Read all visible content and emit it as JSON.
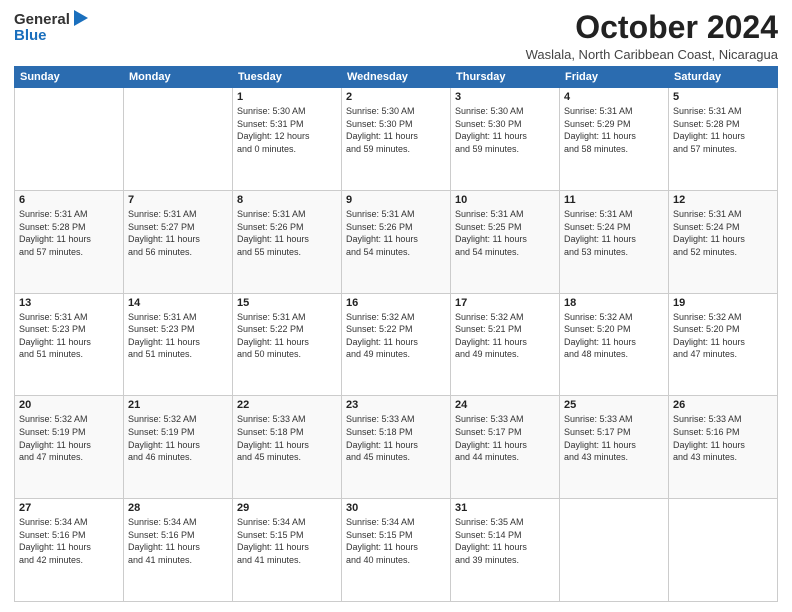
{
  "logo": {
    "general": "General",
    "blue": "Blue"
  },
  "title": {
    "month": "October 2024",
    "location": "Waslala, North Caribbean Coast, Nicaragua"
  },
  "weekdays": [
    "Sunday",
    "Monday",
    "Tuesday",
    "Wednesday",
    "Thursday",
    "Friday",
    "Saturday"
  ],
  "weeks": [
    [
      {
        "day": "",
        "info": ""
      },
      {
        "day": "",
        "info": ""
      },
      {
        "day": "1",
        "info": "Sunrise: 5:30 AM\nSunset: 5:31 PM\nDaylight: 12 hours\nand 0 minutes."
      },
      {
        "day": "2",
        "info": "Sunrise: 5:30 AM\nSunset: 5:30 PM\nDaylight: 11 hours\nand 59 minutes."
      },
      {
        "day": "3",
        "info": "Sunrise: 5:30 AM\nSunset: 5:30 PM\nDaylight: 11 hours\nand 59 minutes."
      },
      {
        "day": "4",
        "info": "Sunrise: 5:31 AM\nSunset: 5:29 PM\nDaylight: 11 hours\nand 58 minutes."
      },
      {
        "day": "5",
        "info": "Sunrise: 5:31 AM\nSunset: 5:28 PM\nDaylight: 11 hours\nand 57 minutes."
      }
    ],
    [
      {
        "day": "6",
        "info": "Sunrise: 5:31 AM\nSunset: 5:28 PM\nDaylight: 11 hours\nand 57 minutes."
      },
      {
        "day": "7",
        "info": "Sunrise: 5:31 AM\nSunset: 5:27 PM\nDaylight: 11 hours\nand 56 minutes."
      },
      {
        "day": "8",
        "info": "Sunrise: 5:31 AM\nSunset: 5:26 PM\nDaylight: 11 hours\nand 55 minutes."
      },
      {
        "day": "9",
        "info": "Sunrise: 5:31 AM\nSunset: 5:26 PM\nDaylight: 11 hours\nand 54 minutes."
      },
      {
        "day": "10",
        "info": "Sunrise: 5:31 AM\nSunset: 5:25 PM\nDaylight: 11 hours\nand 54 minutes."
      },
      {
        "day": "11",
        "info": "Sunrise: 5:31 AM\nSunset: 5:24 PM\nDaylight: 11 hours\nand 53 minutes."
      },
      {
        "day": "12",
        "info": "Sunrise: 5:31 AM\nSunset: 5:24 PM\nDaylight: 11 hours\nand 52 minutes."
      }
    ],
    [
      {
        "day": "13",
        "info": "Sunrise: 5:31 AM\nSunset: 5:23 PM\nDaylight: 11 hours\nand 51 minutes."
      },
      {
        "day": "14",
        "info": "Sunrise: 5:31 AM\nSunset: 5:23 PM\nDaylight: 11 hours\nand 51 minutes."
      },
      {
        "day": "15",
        "info": "Sunrise: 5:31 AM\nSunset: 5:22 PM\nDaylight: 11 hours\nand 50 minutes."
      },
      {
        "day": "16",
        "info": "Sunrise: 5:32 AM\nSunset: 5:22 PM\nDaylight: 11 hours\nand 49 minutes."
      },
      {
        "day": "17",
        "info": "Sunrise: 5:32 AM\nSunset: 5:21 PM\nDaylight: 11 hours\nand 49 minutes."
      },
      {
        "day": "18",
        "info": "Sunrise: 5:32 AM\nSunset: 5:20 PM\nDaylight: 11 hours\nand 48 minutes."
      },
      {
        "day": "19",
        "info": "Sunrise: 5:32 AM\nSunset: 5:20 PM\nDaylight: 11 hours\nand 47 minutes."
      }
    ],
    [
      {
        "day": "20",
        "info": "Sunrise: 5:32 AM\nSunset: 5:19 PM\nDaylight: 11 hours\nand 47 minutes."
      },
      {
        "day": "21",
        "info": "Sunrise: 5:32 AM\nSunset: 5:19 PM\nDaylight: 11 hours\nand 46 minutes."
      },
      {
        "day": "22",
        "info": "Sunrise: 5:33 AM\nSunset: 5:18 PM\nDaylight: 11 hours\nand 45 minutes."
      },
      {
        "day": "23",
        "info": "Sunrise: 5:33 AM\nSunset: 5:18 PM\nDaylight: 11 hours\nand 45 minutes."
      },
      {
        "day": "24",
        "info": "Sunrise: 5:33 AM\nSunset: 5:17 PM\nDaylight: 11 hours\nand 44 minutes."
      },
      {
        "day": "25",
        "info": "Sunrise: 5:33 AM\nSunset: 5:17 PM\nDaylight: 11 hours\nand 43 minutes."
      },
      {
        "day": "26",
        "info": "Sunrise: 5:33 AM\nSunset: 5:16 PM\nDaylight: 11 hours\nand 43 minutes."
      }
    ],
    [
      {
        "day": "27",
        "info": "Sunrise: 5:34 AM\nSunset: 5:16 PM\nDaylight: 11 hours\nand 42 minutes."
      },
      {
        "day": "28",
        "info": "Sunrise: 5:34 AM\nSunset: 5:16 PM\nDaylight: 11 hours\nand 41 minutes."
      },
      {
        "day": "29",
        "info": "Sunrise: 5:34 AM\nSunset: 5:15 PM\nDaylight: 11 hours\nand 41 minutes."
      },
      {
        "day": "30",
        "info": "Sunrise: 5:34 AM\nSunset: 5:15 PM\nDaylight: 11 hours\nand 40 minutes."
      },
      {
        "day": "31",
        "info": "Sunrise: 5:35 AM\nSunset: 5:14 PM\nDaylight: 11 hours\nand 39 minutes."
      },
      {
        "day": "",
        "info": ""
      },
      {
        "day": "",
        "info": ""
      }
    ]
  ]
}
